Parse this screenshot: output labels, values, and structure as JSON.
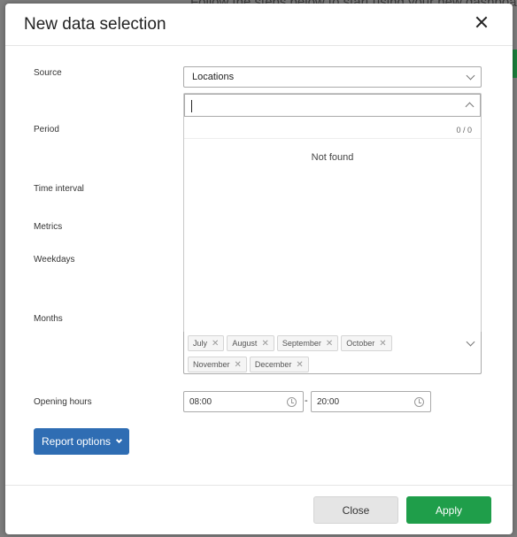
{
  "background": {
    "text": "Follow the steps below to start using your new dashboard"
  },
  "modal": {
    "title": "New data selection",
    "close_icon": "close-icon"
  },
  "form": {
    "source_label": "Source",
    "source_value": "Locations",
    "period_label": "Period",
    "time_interval_label": "Time interval",
    "metrics_label": "Metrics",
    "weekdays_label": "Weekdays",
    "months_label": "Months",
    "opening_hours_label": "Opening hours",
    "opening_start": "08:00",
    "opening_end": "20:00",
    "opening_separator": "-"
  },
  "dropdown": {
    "search_value": "",
    "count": "0 / 0",
    "empty_text": "Not found"
  },
  "months_selected": [
    "July",
    "August",
    "September",
    "October",
    "November",
    "December"
  ],
  "buttons": {
    "report_options": "Report options",
    "close": "Close",
    "apply": "Apply"
  },
  "colors": {
    "primary": "#2f6db3",
    "apply": "#1f9e4a"
  }
}
